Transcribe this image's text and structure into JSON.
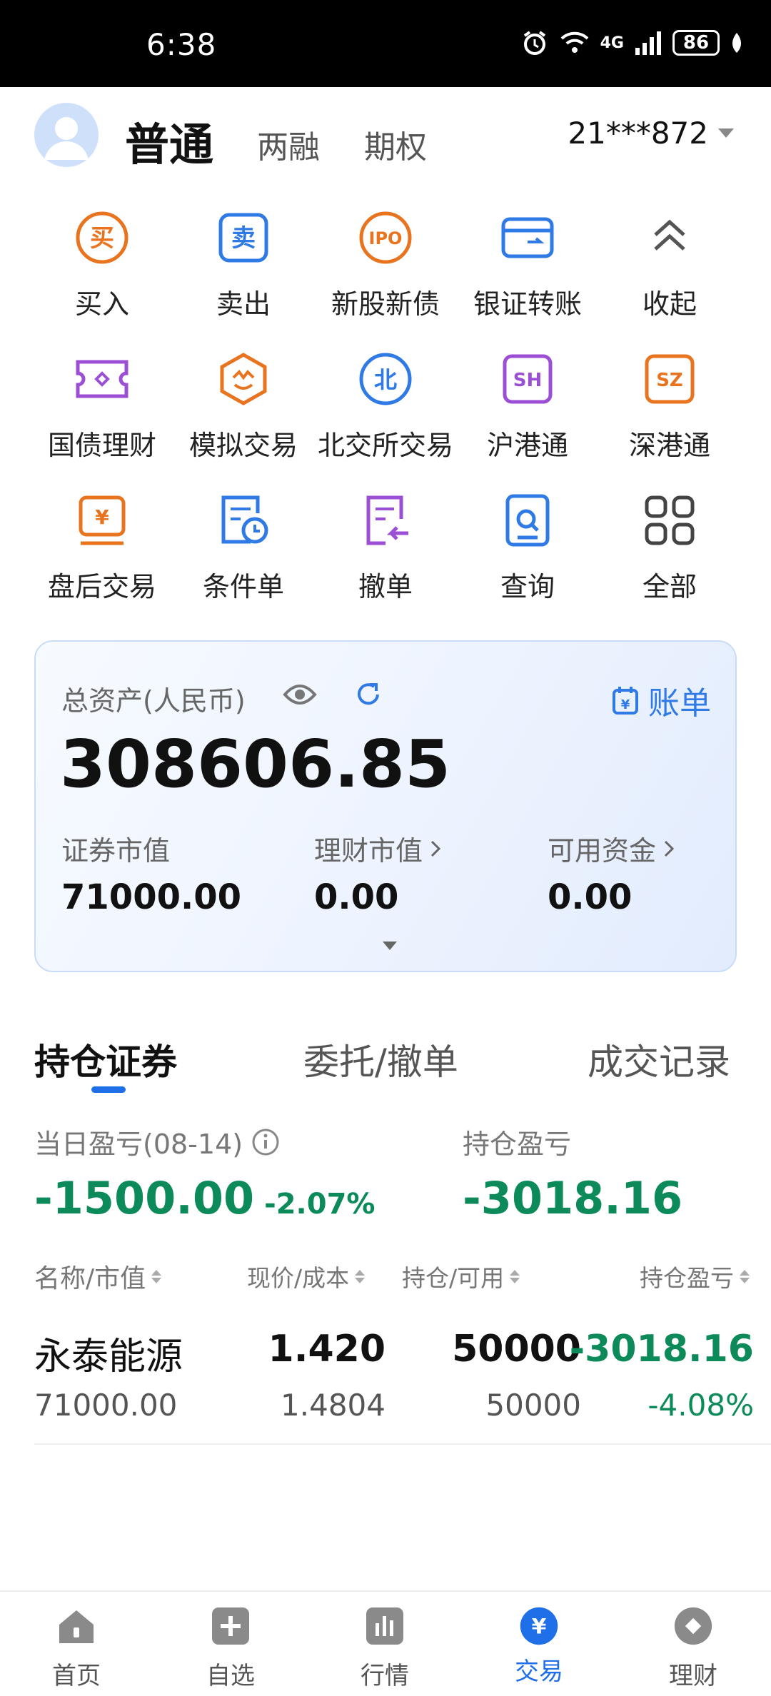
{
  "status_bar": {
    "time": "6:38",
    "network": "4G",
    "battery": "86"
  },
  "header": {
    "active_tab": "普通",
    "tabs": [
      "两融",
      "期权"
    ],
    "account_id": "21***872"
  },
  "quick_actions": [
    {
      "label": "买入",
      "icon": "buy-icon"
    },
    {
      "label": "卖出",
      "icon": "sell-icon"
    },
    {
      "label": "新股新债",
      "icon": "ipo-icon"
    },
    {
      "label": "银证转账",
      "icon": "bank-card-icon"
    },
    {
      "label": "收起",
      "icon": "collapse-icon"
    },
    {
      "label": "国债理财",
      "icon": "bond-ticket-icon"
    },
    {
      "label": "模拟交易",
      "icon": "simulation-icon"
    },
    {
      "label": "北交所交易",
      "icon": "bse-icon"
    },
    {
      "label": "沪港通",
      "icon": "sh-connect-icon"
    },
    {
      "label": "深港通",
      "icon": "sz-connect-icon"
    },
    {
      "label": "盘后交易",
      "icon": "after-hours-icon"
    },
    {
      "label": "条件单",
      "icon": "conditional-order-icon"
    },
    {
      "label": "撤单",
      "icon": "cancel-order-icon"
    },
    {
      "label": "查询",
      "icon": "query-icon"
    },
    {
      "label": "全部",
      "icon": "all-grid-icon"
    }
  ],
  "icon_glyphs": {
    "buy": "买",
    "sell": "卖",
    "ipo": "IPO",
    "bse": "北",
    "sh": "SH",
    "sz": "SZ",
    "yen": "¥"
  },
  "assets": {
    "total_label": "总资产(人民币)",
    "total_value": "308606.85",
    "bill_label": "账单",
    "securities_label": "证券市值",
    "securities_value": "71000.00",
    "wealth_label": "理财市值",
    "wealth_value": "0.00",
    "available_label": "可用资金",
    "available_value": "0.00"
  },
  "tabs": [
    "持仓证券",
    "委托/撤单",
    "成交记录"
  ],
  "pnl": {
    "daily_label": "当日盈亏(08-14)",
    "daily_value": "-1500.00",
    "daily_pct": "-2.07%",
    "position_label": "持仓盈亏",
    "position_value": "-3018.16"
  },
  "table": {
    "headers": [
      "名称/市值",
      "现价/成本",
      "持仓/可用",
      "持仓盈亏"
    ],
    "rows": [
      {
        "name": "永泰能源",
        "market_value": "71000.00",
        "price": "1.420",
        "cost": "1.4804",
        "holding": "50000",
        "available": "50000",
        "pnl": "-3018.16",
        "pnl_pct": "-4.08%"
      }
    ]
  },
  "bottom_nav": [
    {
      "label": "首页",
      "icon": "home-icon"
    },
    {
      "label": "自选",
      "icon": "watchlist-add-icon"
    },
    {
      "label": "行情",
      "icon": "market-chart-icon"
    },
    {
      "label": "交易",
      "icon": "trade-yen-icon",
      "active": true
    },
    {
      "label": "理财",
      "icon": "wealth-diamond-icon"
    }
  ],
  "colors": {
    "accent": "#1e6fe8",
    "loss_green": "#0c8a5a",
    "orange": "#e8741f",
    "purple": "#9b4fd4"
  }
}
